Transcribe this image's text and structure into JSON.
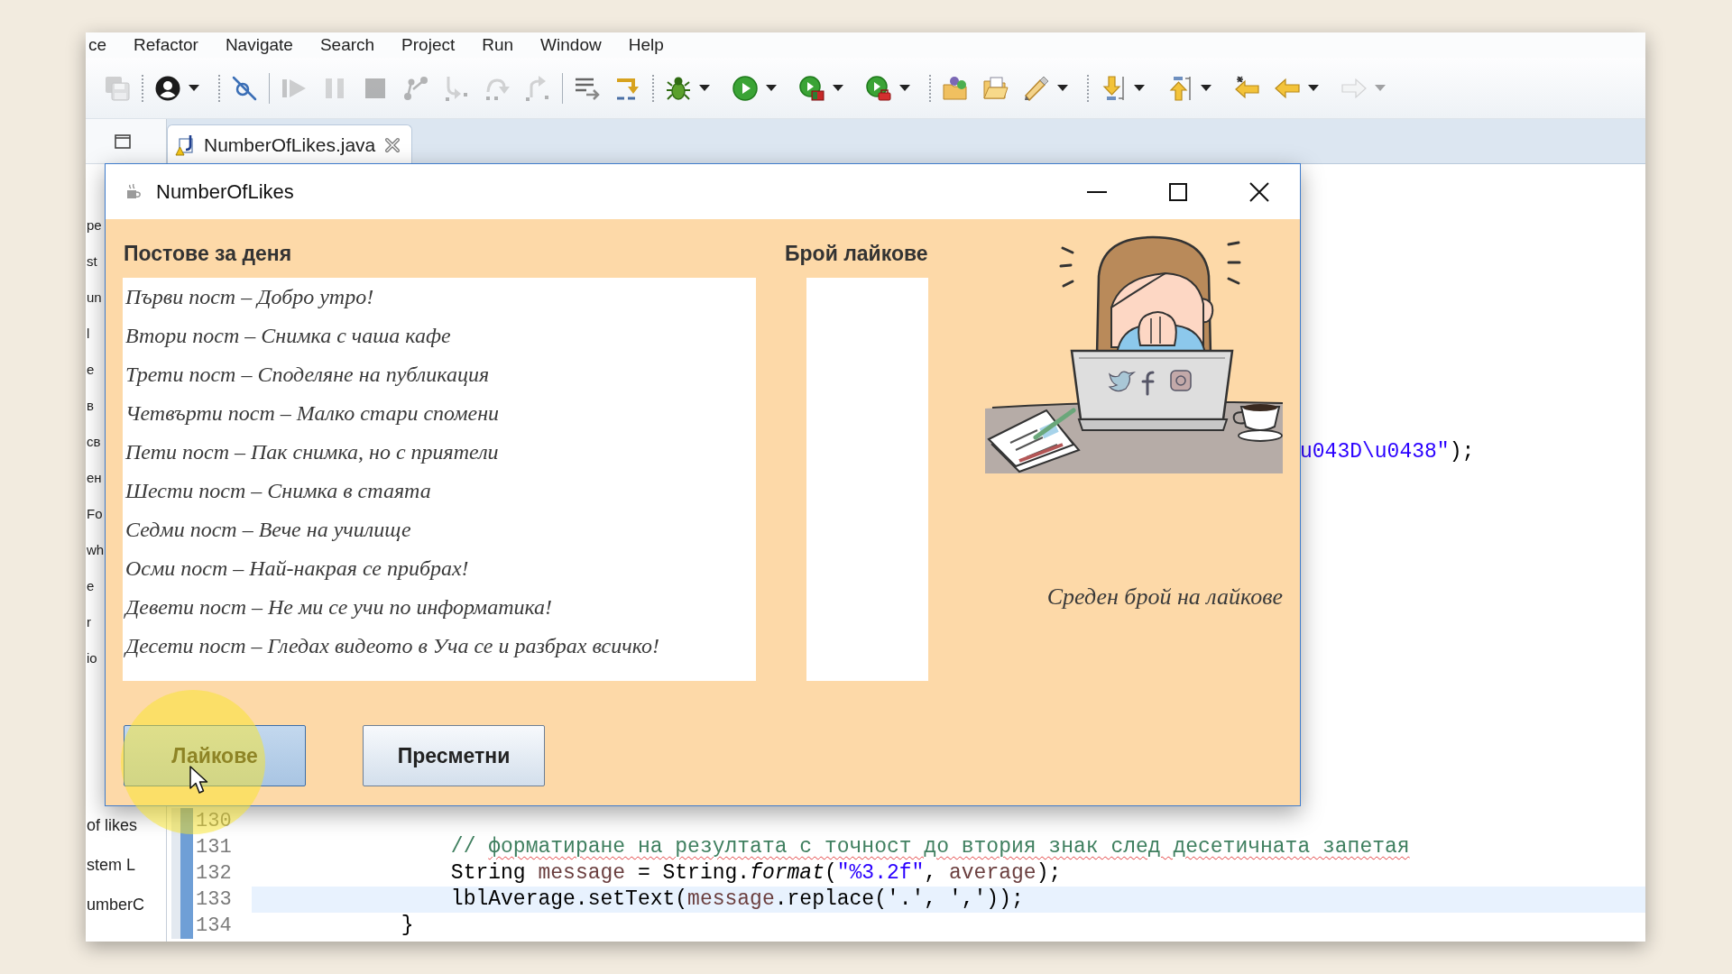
{
  "ide": {
    "menu": [
      "ce",
      "Refactor",
      "Navigate",
      "Search",
      "Project",
      "Run",
      "Window",
      "Help"
    ],
    "toolbar": [
      {
        "kind": "dotted",
        "items": [
          {
            "kind": "save-all",
            "disabled": true,
            "dropdown": false
          }
        ]
      },
      {
        "kind": "dotted",
        "items": [
          {
            "kind": "user",
            "disabled": false,
            "dropdown": true
          }
        ]
      },
      {
        "kind": "solid",
        "items": [
          {
            "kind": "skip-breakpoints",
            "disabled": false,
            "dropdown": false
          }
        ]
      },
      {
        "kind": "solid",
        "items": [
          {
            "kind": "resume",
            "disabled": true,
            "dropdown": false
          },
          {
            "kind": "suspend",
            "disabled": true,
            "dropdown": false
          },
          {
            "kind": "terminate",
            "disabled": true,
            "dropdown": false
          },
          {
            "kind": "disconnect",
            "disabled": true,
            "dropdown": false
          },
          {
            "kind": "step-into",
            "disabled": true,
            "dropdown": false
          },
          {
            "kind": "step-over",
            "disabled": true,
            "dropdown": false
          },
          {
            "kind": "step-return",
            "disabled": true,
            "dropdown": false
          }
        ]
      },
      {
        "kind": "dotted",
        "items": [
          {
            "kind": "step-filters",
            "disabled": false,
            "dropdown": false
          },
          {
            "kind": "drop-to-frame",
            "disabled": false,
            "dropdown": false
          }
        ]
      },
      {
        "kind": "dotted",
        "items": [
          {
            "kind": "debug",
            "disabled": false,
            "dropdown": true
          },
          {
            "kind": "run",
            "disabled": false,
            "dropdown": true
          },
          {
            "kind": "coverage",
            "disabled": false,
            "dropdown": true
          },
          {
            "kind": "external-tools",
            "disabled": false,
            "dropdown": true
          }
        ]
      },
      {
        "kind": "dotted",
        "items": [
          {
            "kind": "open-type",
            "disabled": false,
            "dropdown": false
          },
          {
            "kind": "open-folder",
            "disabled": false,
            "dropdown": false
          },
          {
            "kind": "search",
            "disabled": false,
            "dropdown": true
          }
        ]
      },
      {
        "kind": "last",
        "items": [
          {
            "kind": "next-annotation",
            "disabled": false,
            "dropdown": true
          },
          {
            "kind": "previous-annotation",
            "disabled": false,
            "dropdown": true
          },
          {
            "kind": "last-edit",
            "disabled": false,
            "dropdown": false
          },
          {
            "kind": "back",
            "disabled": false,
            "dropdown": true
          },
          {
            "kind": "forward",
            "disabled": true,
            "dropdown": true
          }
        ]
      }
    ],
    "explorer": {
      "items_above": [
        "pe",
        "st",
        "un",
        "l",
        "e",
        "в",
        "св",
        "ен",
        "Fo",
        "wh",
        "e",
        "r",
        "io"
      ],
      "items_below": [
        "of likes",
        "stem L",
        "umberC"
      ]
    },
    "editor_tabs": [
      {
        "label": "NumberOfLikes.java",
        "selected": true,
        "has_warning": true
      }
    ],
    "code": {
      "fragment": [
        {
          "kind": "string",
          "text": "u043D\\u0438\""
        },
        {
          "kind": "plain",
          "text": ");"
        }
      ],
      "lines": [
        {
          "number": "130",
          "current": false
        },
        {
          "number": "131",
          "current": false,
          "tokens": [
            {
              "kind": "comment",
              "text": "\t\t\t\t// "
            },
            {
              "kind": "misspelled",
              "text": "форматиране на резултата с точност до втория знак след десетичната запетая"
            }
          ]
        },
        {
          "number": "132",
          "current": false,
          "tokens": [
            {
              "kind": "plain",
              "text": "\t\t\t\tString "
            },
            {
              "kind": "local",
              "text": "message"
            },
            {
              "kind": "plain",
              "text": " = String."
            },
            {
              "kind": "static",
              "text": "format"
            },
            {
              "kind": "plain",
              "text": "("
            },
            {
              "kind": "string",
              "text": "\"%3.2f\""
            },
            {
              "kind": "plain",
              "text": ", "
            },
            {
              "kind": "local",
              "text": "average"
            },
            {
              "kind": "plain",
              "text": ");"
            }
          ]
        },
        {
          "number": "133",
          "current": true,
          "tokens": [
            {
              "kind": "plain",
              "text": "\t\t\t\tlblAverage.setText("
            },
            {
              "kind": "local",
              "text": "message"
            },
            {
              "kind": "plain",
              "text": ".replace('.', ','));"
            }
          ]
        },
        {
          "number": "134",
          "current": false,
          "tokens": [
            {
              "kind": "plain",
              "text": "\t\t\t}"
            }
          ]
        }
      ]
    }
  },
  "dialog": {
    "title": "NumberOfLikes",
    "posts_label": "Постове за деня",
    "posts": [
      {
        "text": "Първи пост – Добро утро!",
        "selected": false
      },
      {
        "text": "Втори пост – Снимка с чаша кафе",
        "selected": false
      },
      {
        "text": "Трети пост – Споделяне на публикация",
        "selected": false
      },
      {
        "text": "Четвърти пост – Малко стари спомени",
        "selected": false
      },
      {
        "text": "Пети пост – Пак снимка, но с приятели",
        "selected": false
      },
      {
        "text": "Шести пост – Снимка в стаята",
        "selected": false
      },
      {
        "text": "Седми пост – Вече на училище",
        "selected": false
      },
      {
        "text": "Осми пост – Най-накрая се прибрах!",
        "selected": false
      },
      {
        "text": "Девети пост – Не ми се учи по информатика!",
        "selected": false
      },
      {
        "text": "Десети пост – Гледах видеото в Уча се и разбрах всичко!",
        "selected": false
      }
    ],
    "likes_label": "Брой лайкове",
    "average_label": "Среден брой на лайкове",
    "buttons": [
      {
        "label": "Лайкове",
        "hovered": true
      },
      {
        "label": "Пресметни",
        "hovered": false
      }
    ]
  },
  "mouse_pointer": {
    "highlighted": true
  }
}
